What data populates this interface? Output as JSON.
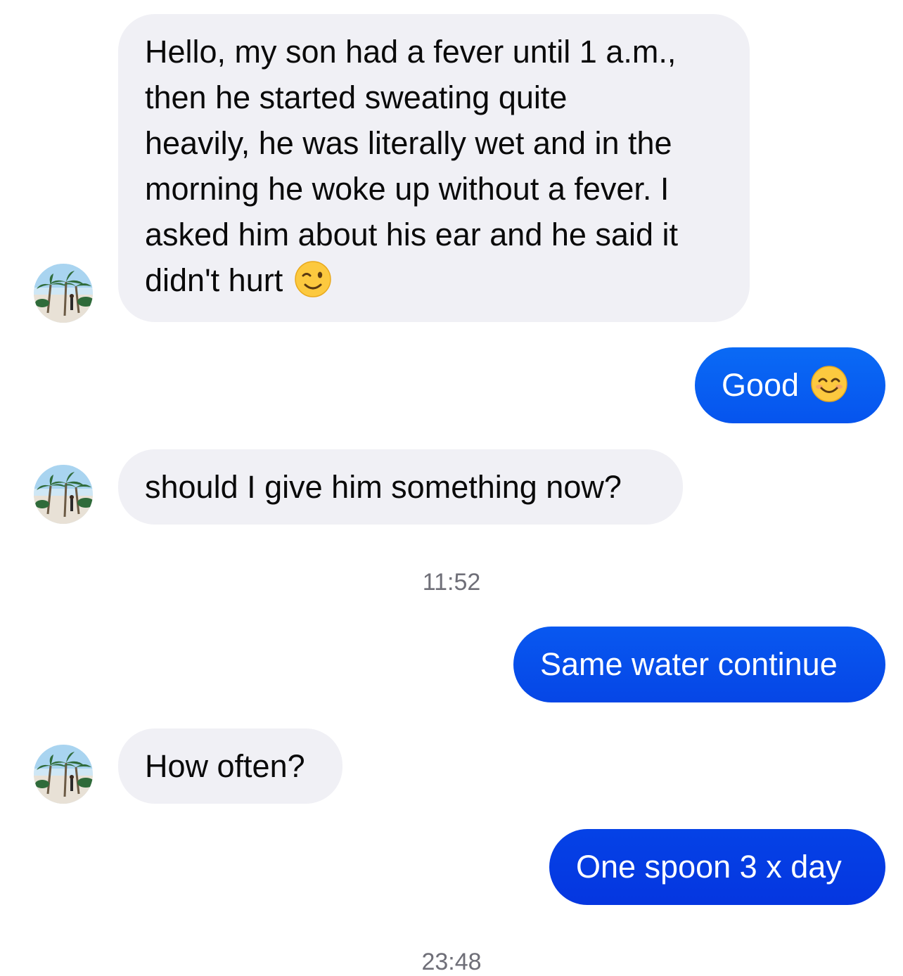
{
  "conversation": {
    "messages": [
      {
        "direction": "incoming",
        "lines": [
          "Hello, my son had a fever until 1 a.m.,",
          "then he started sweating quite",
          "heavily, he was literally wet and in the",
          "morning he woke up without a fever. I",
          "asked him about his ear and he said it",
          "didn't hurt"
        ],
        "emoji": "winking-face-emoji"
      },
      {
        "direction": "outgoing",
        "text": "Good",
        "emoji": "smiling-face-emoji"
      },
      {
        "direction": "incoming",
        "text": "should I give him something now?"
      },
      {
        "direction": "outgoing",
        "text": "Same water continue"
      },
      {
        "direction": "incoming",
        "text": "How often?"
      },
      {
        "direction": "outgoing",
        "text": "One spoon 3 x day"
      }
    ],
    "timestamps": [
      "11:52",
      "23:48"
    ]
  },
  "colors": {
    "incoming_bubble": "#f0f0f5",
    "outgoing_bubble_top": "#0a6af5",
    "outgoing_bubble_bottom": "#0536e0",
    "timestamp_text": "#6f6f78"
  },
  "icons": {
    "avatar": "contact-avatar-beach-palms"
  }
}
